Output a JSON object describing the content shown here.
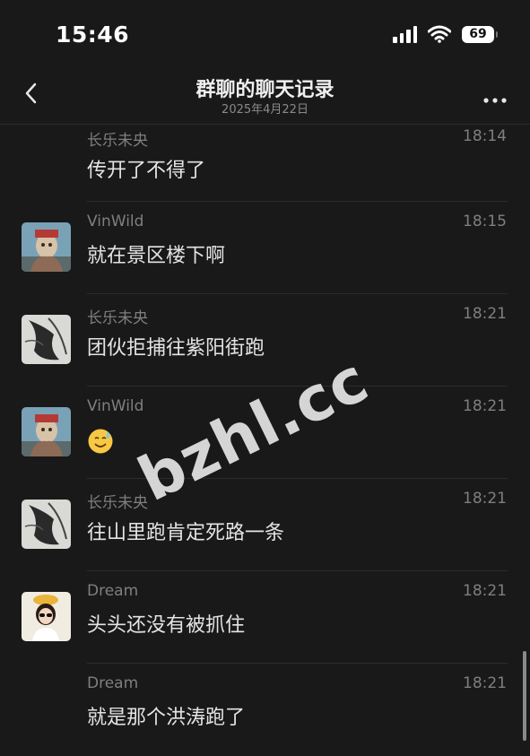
{
  "status_bar": {
    "time": "15:46",
    "battery": "69"
  },
  "nav": {
    "title": "群聊的聊天记录",
    "subtitle": "2025年4月22日"
  },
  "messages": [
    {
      "name": "长乐未央",
      "time": "18:14",
      "text": "传开了不得了"
    },
    {
      "name": "VinWild",
      "time": "18:15",
      "text": "就在景区楼下啊"
    },
    {
      "name": "长乐未央",
      "time": "18:21",
      "text": "团伙拒捕往紫阳街跑"
    },
    {
      "name": "VinWild",
      "time": "18:21",
      "text": "",
      "emoji": "sweat-smile-emoji"
    },
    {
      "name": "长乐未央",
      "time": "18:21",
      "text": "往山里跑肯定死路一条"
    },
    {
      "name": "Dream",
      "time": "18:21",
      "text": "头头还没有被抓住"
    },
    {
      "name": "Dream",
      "time": "18:21",
      "text": "就是那个洪涛跑了"
    }
  ],
  "watermark": "bzhl.cc"
}
